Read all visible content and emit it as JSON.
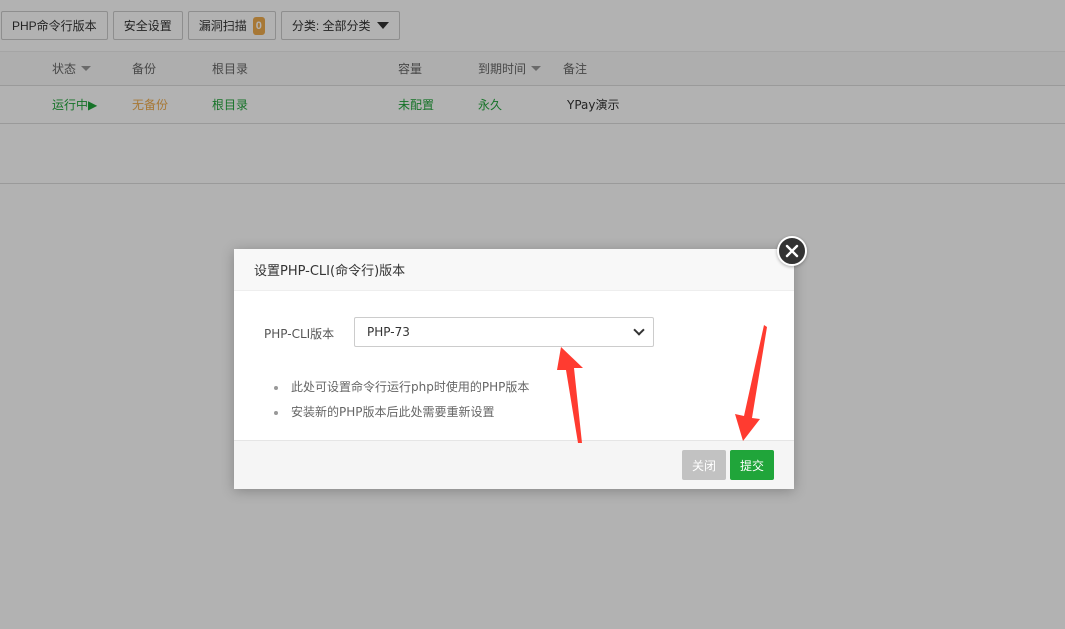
{
  "toolbar": {
    "php_cli_btn": "PHP命令行版本",
    "security_btn": "安全设置",
    "scan_btn": "漏洞扫描",
    "scan_count": "0",
    "category_btn": "分类: 全部分类"
  },
  "table": {
    "headers": {
      "status": "状态",
      "backup": "备份",
      "root": "根目录",
      "quota": "容量",
      "expire": "到期时间",
      "note": "备注"
    },
    "row": {
      "status": "运行中▶",
      "backup": "无备份",
      "root": "根目录",
      "quota": "未配置",
      "expire": "永久",
      "note": "YPay演示"
    }
  },
  "modal": {
    "title": "设置PHP-CLI(命令行)版本",
    "field_label": "PHP-CLI版本",
    "selected_version": "PHP-73",
    "tips": [
      "此处可设置命令行运行php时使用的PHP版本",
      "安装新的PHP版本后此处需要重新设置"
    ],
    "close_label": "关闭",
    "submit_label": "提交"
  },
  "colors": {
    "green": "#20a53a",
    "orange": "#f0ad4e",
    "annotation_red": "#ff3b30"
  }
}
